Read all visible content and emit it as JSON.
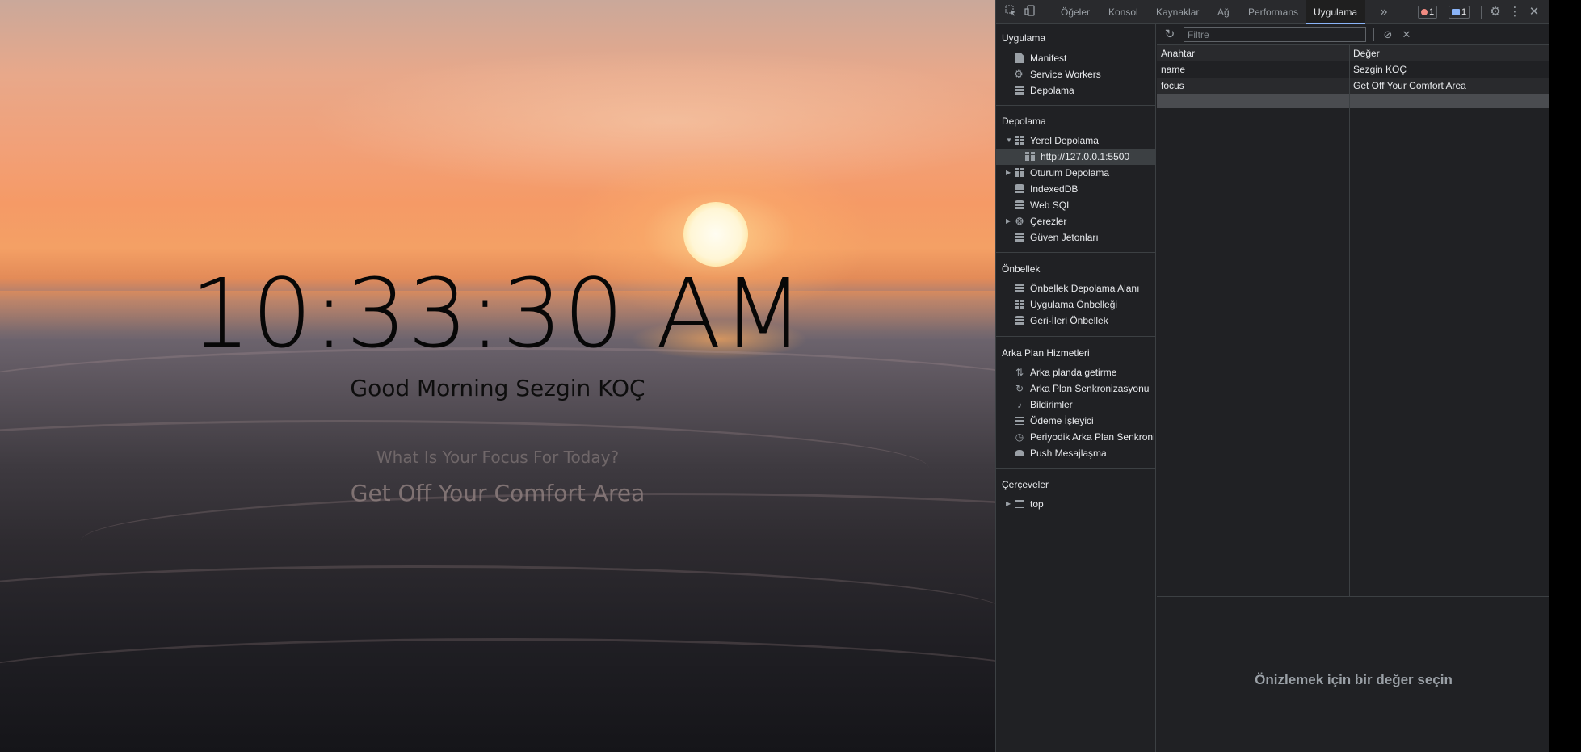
{
  "page": {
    "clock": "10:33:30 AM",
    "greeting": "Good Morning Sezgin KOÇ",
    "focus_question": "What Is Your Focus For Today?",
    "focus_value": "Get Off Your Comfort Area"
  },
  "devtools": {
    "tabs": [
      "Öğeler",
      "Konsol",
      "Kaynaklar",
      "Ağ",
      "Performans",
      "Uygulama"
    ],
    "active_tab": "Uygulama",
    "error_count": "1",
    "message_count": "1",
    "sidebar": {
      "application": {
        "title": "Uygulama",
        "items": [
          {
            "label": "Manifest",
            "icon": "file-icon"
          },
          {
            "label": "Service Workers",
            "icon": "gear-icon"
          },
          {
            "label": "Depolama",
            "icon": "database-icon"
          }
        ]
      },
      "storage": {
        "title": "Depolama",
        "items": [
          {
            "label": "Yerel Depolama",
            "icon": "grid-icon",
            "expanded": true
          },
          {
            "label": "http://127.0.0.1:5500",
            "icon": "grid-icon",
            "selected": true
          },
          {
            "label": "Oturum Depolama",
            "icon": "grid-icon",
            "expanded": false
          },
          {
            "label": "IndexedDB",
            "icon": "database-icon"
          },
          {
            "label": "Web SQL",
            "icon": "database-icon"
          },
          {
            "label": "Çerezler",
            "icon": "cookie-icon",
            "expanded": false
          },
          {
            "label": "Güven Jetonları",
            "icon": "database-icon"
          }
        ]
      },
      "cache": {
        "title": "Önbellek",
        "items": [
          {
            "label": "Önbellek Depolama Alanı",
            "icon": "database-icon"
          },
          {
            "label": "Uygulama Önbelleği",
            "icon": "grid-icon"
          },
          {
            "label": "Geri-İleri Önbellek",
            "icon": "database-icon"
          }
        ]
      },
      "background": {
        "title": "Arka Plan Hizmetleri",
        "items": [
          {
            "label": "Arka planda getirme",
            "icon": "fetch-arrows-icon"
          },
          {
            "label": "Arka Plan Senkronizasyonu",
            "icon": "sync-icon"
          },
          {
            "label": "Bildirimler",
            "icon": "bell-icon"
          },
          {
            "label": "Ödeme İşleyici",
            "icon": "card-icon"
          },
          {
            "label": "Periyodik Arka Plan Senkronizasyonu",
            "icon": "clock-icon"
          },
          {
            "label": "Push Mesajlaşma",
            "icon": "cloud-icon"
          }
        ]
      },
      "frames": {
        "title": "Çerçeveler",
        "items": [
          {
            "label": "top",
            "icon": "frame-icon",
            "expanded": false
          }
        ]
      }
    },
    "filter": {
      "placeholder": "Filtre",
      "value": ""
    },
    "table": {
      "columns": [
        "Anahtar",
        "Değer"
      ],
      "rows": [
        {
          "key": "name",
          "value": "Sezgin KOÇ"
        },
        {
          "key": "focus",
          "value": "Get Off Your Comfort Area"
        }
      ]
    },
    "preview_placeholder": "Önizlemek için bir değer seçin"
  }
}
